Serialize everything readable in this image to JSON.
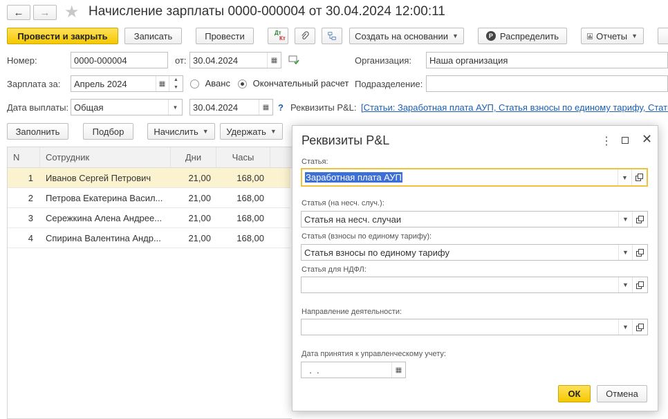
{
  "window": {
    "title": "Начисление зарплаты 0000-000004 от 30.04.2024 12:00:11"
  },
  "toolbar": {
    "post_close": "Провести и закрыть",
    "save": "Записать",
    "post": "Провести",
    "create_based": "Создать на основании",
    "distribute": "Распределить",
    "reports": "Отчеты",
    "dtkt_top": "Дт",
    "dtkt_bottom": "Кт"
  },
  "form": {
    "number_label": "Номер:",
    "number_value": "0000-000004",
    "date_label": "от:",
    "date_value": "30.04.2024",
    "org_label": "Организация:",
    "org_value": "Наша организация",
    "salary_for_label": "Зарплата за:",
    "salary_for_value": "Апрель 2024",
    "advance_label": "Аванс",
    "final_label": "Окончательный расчет",
    "division_label": "Подразделение:",
    "division_value": "",
    "pay_date_label": "Дата выплаты:",
    "pay_type_value": "Общая",
    "pay_date_value": "30.04.2024",
    "help_mark": "?",
    "pl_label": "Реквизиты P&L:",
    "pl_link": "[Статьи: Заработная плата АУП, Статья взносы по единому тарифу, Статья"
  },
  "table_toolbar": {
    "fill": "Заполнить",
    "select": "Подбор",
    "accrue": "Начислить",
    "withhold": "Удержать"
  },
  "table": {
    "headers": [
      "N",
      "Сотрудник",
      "Дни",
      "Часы"
    ],
    "rows": [
      {
        "n": "1",
        "employee": "Иванов Сергей Петрович",
        "days": "21,00",
        "hours": "168,00"
      },
      {
        "n": "2",
        "employee": "Петрова Екатерина Васил...",
        "days": "21,00",
        "hours": "168,00"
      },
      {
        "n": "3",
        "employee": "Сережкина Алена Андрее...",
        "days": "21,00",
        "hours": "168,00"
      },
      {
        "n": "4",
        "employee": "Спирина Валентина Андр...",
        "days": "21,00",
        "hours": "168,00"
      }
    ]
  },
  "dialog": {
    "title": "Реквизиты P&L",
    "article_label": "Статья:",
    "article_value": "Заработная плата АУП",
    "accident_label": "Статья (на несч. случ.):",
    "accident_value": "Статья на несч. случаи",
    "contrib_label": "Статья (взносы по единому тарифу):",
    "contrib_value": "Статья взносы по единому тарифу",
    "ndfl_label": "Статья для НДФЛ:",
    "ndfl_value": "",
    "direction_label": "Направление деятельности:",
    "direction_value": "",
    "date_label": "Дата принятия к управленческому учету:",
    "date_value": "  .  .",
    "ok": "ОК",
    "cancel": "Отмена"
  },
  "colors": {
    "accent_yellow": "#f5c800",
    "selected_row": "#fbf3cf",
    "link_blue": "#1a5fb4",
    "focus_border": "#f0c23a"
  }
}
